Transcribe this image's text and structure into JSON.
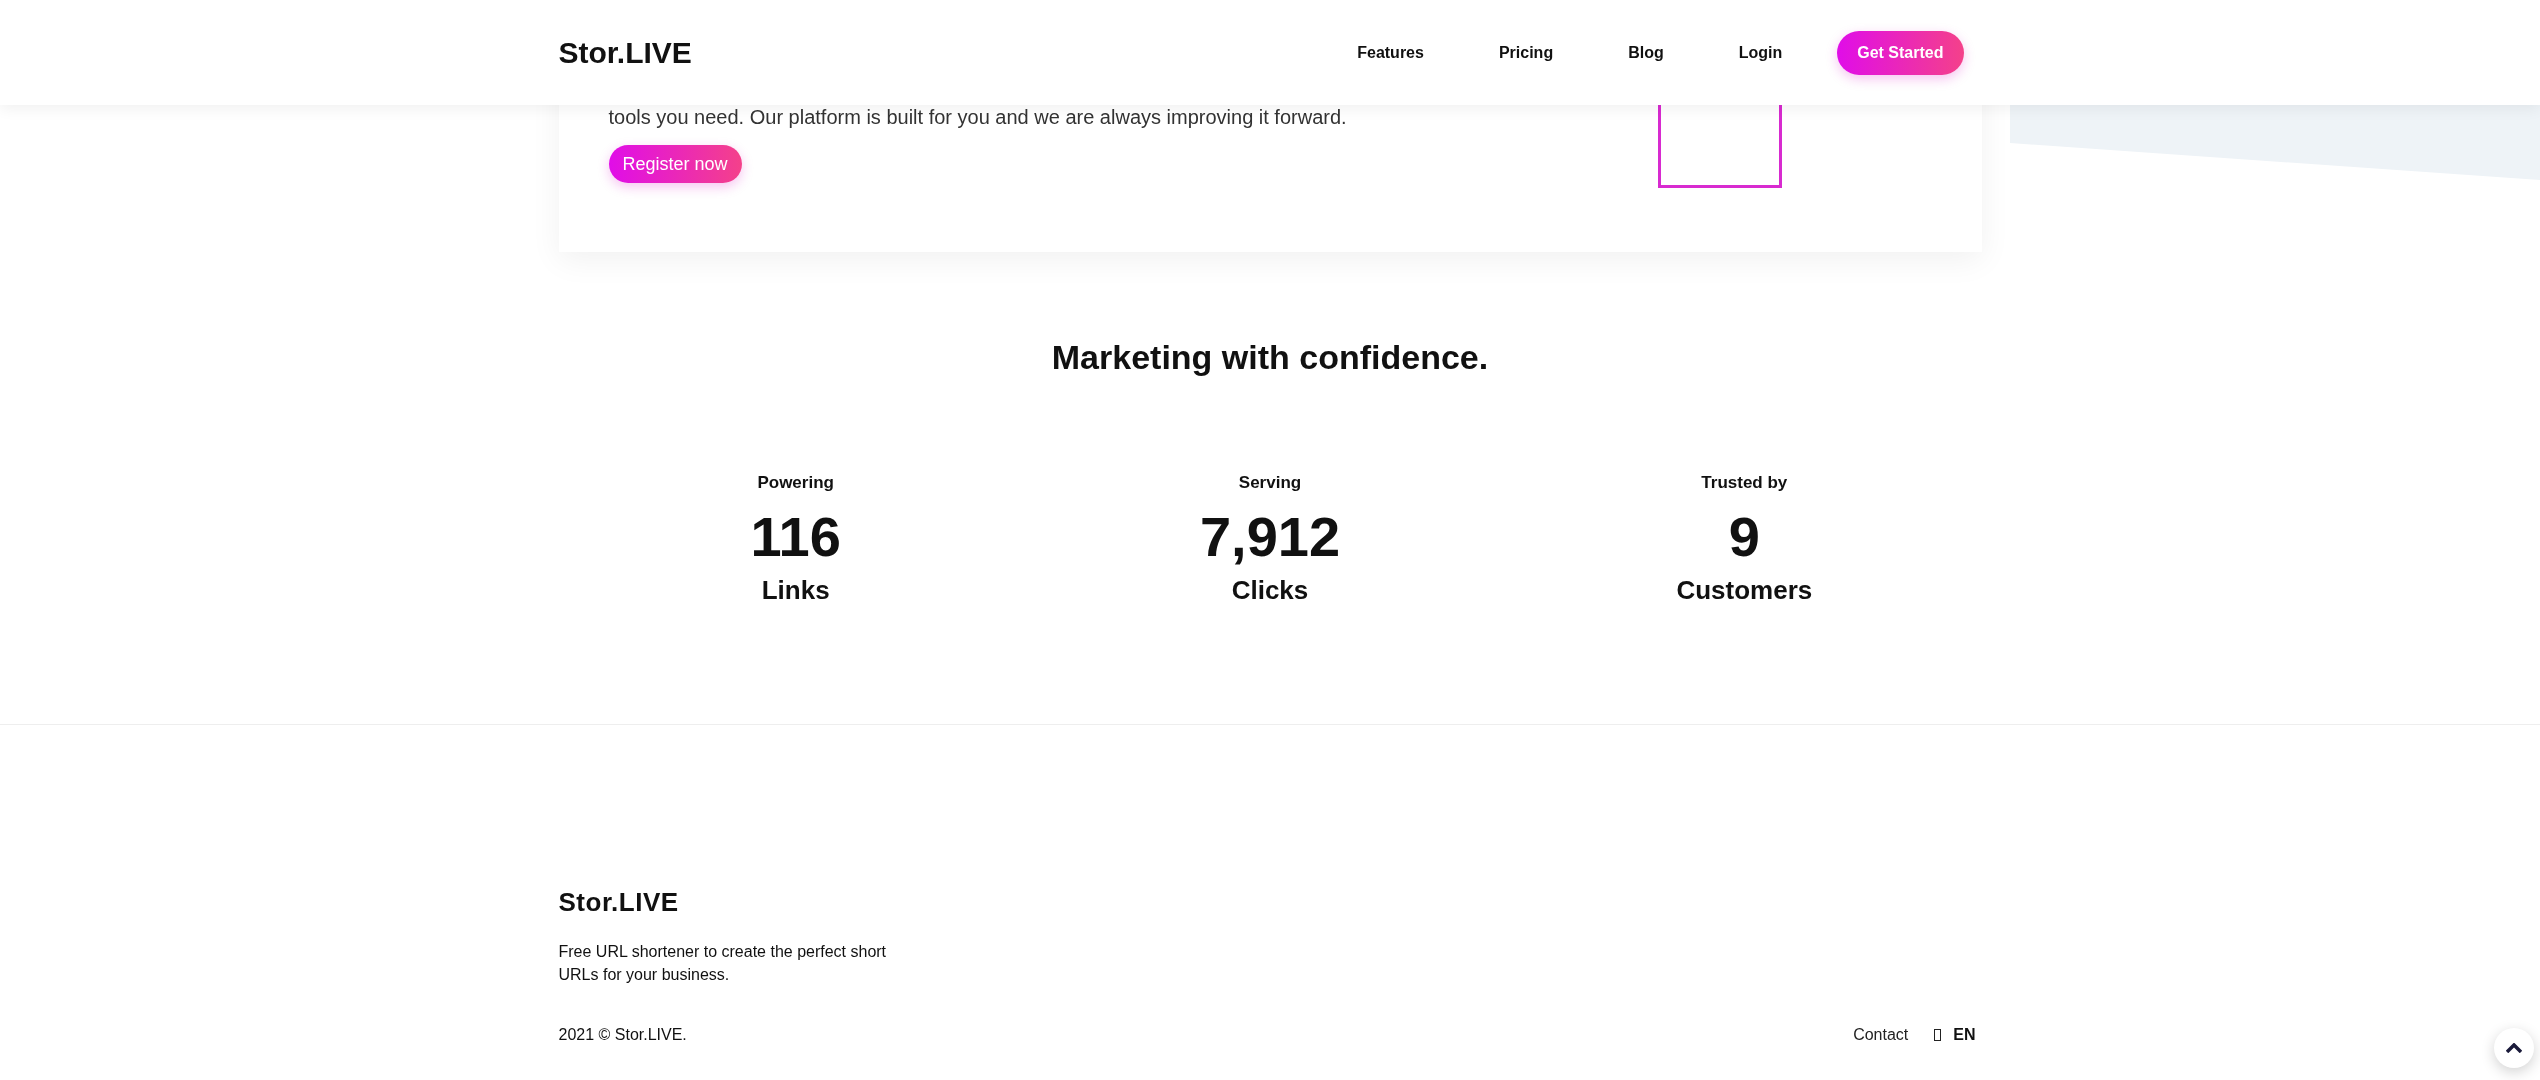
{
  "header": {
    "logo": "Stor.LIVE",
    "nav": [
      {
        "label": "Features"
      },
      {
        "label": "Pricing"
      },
      {
        "label": "Blog"
      },
      {
        "label": "Login"
      }
    ],
    "cta": "Get Started"
  },
  "card": {
    "text": "tools you need. Our platform is built for you and we are always improving it forward.",
    "button": "Register now"
  },
  "stats": {
    "title": "Marketing with confidence.",
    "items": [
      {
        "label": "Powering",
        "value": "116",
        "unit": "Links"
      },
      {
        "label": "Serving",
        "value": "7,912",
        "unit": "Clicks"
      },
      {
        "label": "Trusted by",
        "value": "9",
        "unit": "Customers"
      }
    ]
  },
  "footer": {
    "logo": "Stor.LIVE",
    "description": "Free URL shortener to create the perfect short URLs for your business.",
    "copyright": "2021 © Stor.LIVE.",
    "links": [
      {
        "label": "Contact"
      }
    ],
    "language": "EN"
  }
}
